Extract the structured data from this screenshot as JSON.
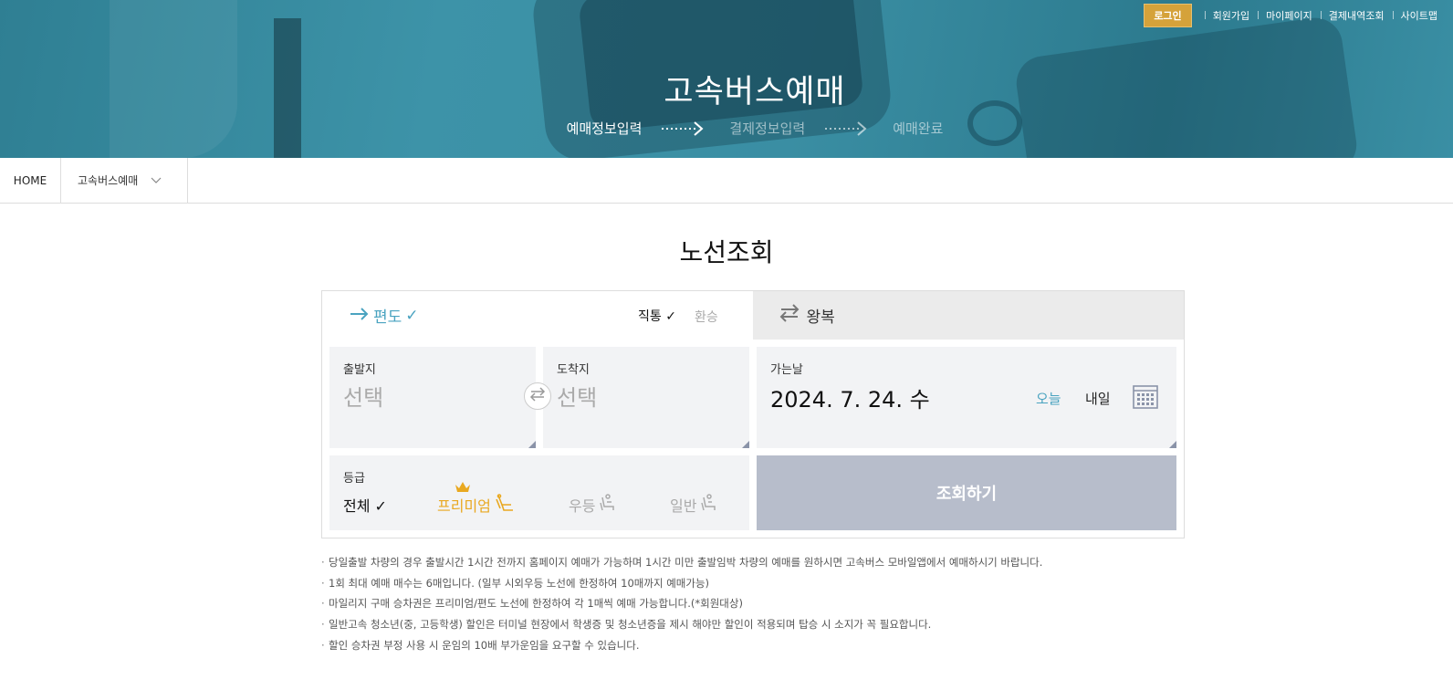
{
  "topnav": {
    "login": "로그인",
    "links": [
      "회원가입",
      "마이페이지",
      "결제내역조회",
      "사이트맵"
    ]
  },
  "hero": {
    "title": "고속버스예매",
    "steps": [
      "예매정보입력",
      "결제정보입력",
      "예매완료"
    ]
  },
  "breadcrumb": {
    "home": "HOME",
    "current": "고속버스예매"
  },
  "page_title": "노선조회",
  "tabs": {
    "oneway": "편도",
    "oneway_check": "✓",
    "direct": "직통 ✓",
    "transfer": "환승",
    "roundtrip": "왕복"
  },
  "form": {
    "departure_label": "출발지",
    "departure_placeholder": "선택",
    "arrival_label": "도착지",
    "arrival_placeholder": "선택",
    "date_label": "가는날",
    "date_value": "2024. 7. 24. 수",
    "today": "오늘",
    "tomorrow": "내일",
    "grade_label": "등급",
    "grades": {
      "all": "전체 ✓",
      "premium": "프리미엄",
      "udeung": "우등",
      "general": "일반"
    },
    "search_button": "조회하기"
  },
  "notes": [
    "당일출발 차량의 경우 출발시간 1시간 전까지 홈페이지 예매가 가능하며 1시간 미만 출발임박 차량의 예매를 원하시면 고속버스 모바일앱에서 예매하시기 바랍니다.",
    "1회 최대 예매 매수는 6매입니다. (일부 시외우등 노선에 한정하여 10매까지 예매가능)",
    "마일리지 구매 승차권은 프리미엄/편도 노선에 한정하여 각 1매씩 예매 가능합니다.(*회원대상)",
    "일반고속 청소년(중, 고등학생) 할인은 터미널 현장에서 학생증 및 청소년증을 제시 해야만 할인이 적용되며 탑승 시 소지가 꼭 필요합니다.",
    "할인 승차권 부정 사용 시 운임의 10배 부가운임을 요구할 수 있습니다."
  ],
  "colors": {
    "accent": "#4aa3c0",
    "premium": "#e9a820",
    "login_bg": "#d5a23a",
    "search_bg": "#b7bdcb"
  }
}
